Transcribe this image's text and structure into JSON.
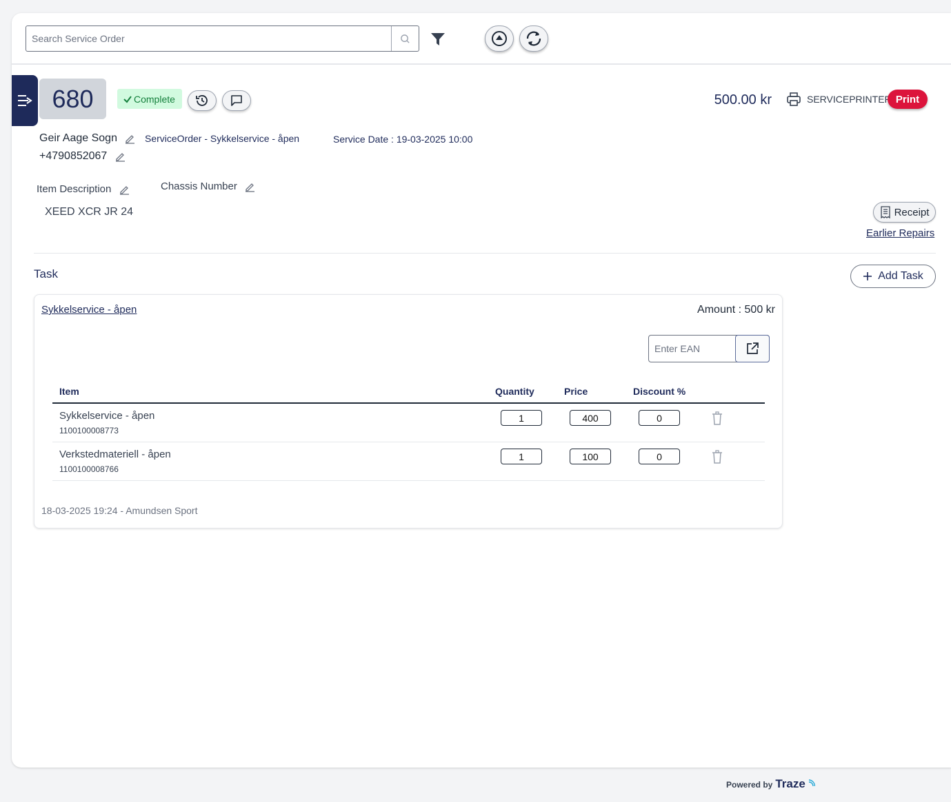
{
  "search": {
    "placeholder": "Search Service Order"
  },
  "order": {
    "number": "680",
    "status": "Complete",
    "total": "500.00 kr",
    "printer_name": "SERVICEPRINTER",
    "print_label": "Print",
    "customer_name": "Geir Aage Sogn",
    "customer_phone": "+4790852067",
    "service_order_label": "ServiceOrder - Sykkelservice - åpen",
    "service_date": "Service Date : 19-03-2025 10:00",
    "item_description_label": "Item Description",
    "item_description_value": "XEED XCR JR 24",
    "chassis_number_label": "Chassis Number",
    "receipt_label": "Receipt",
    "earlier_repairs_label": "Earlier Repairs"
  },
  "task_section": {
    "title": "Task",
    "add_task_label": "Add Task"
  },
  "task": {
    "name": "Sykkelservice - åpen",
    "amount": "Amount : 500 kr",
    "ean_placeholder": "Enter EAN",
    "columns": [
      "Item",
      "Quantity",
      "Price",
      "Discount %"
    ],
    "items": [
      {
        "name": "Sykkelservice - åpen",
        "code": "1100100008773",
        "quantity": "1",
        "price": "400",
        "discount": "0"
      },
      {
        "name": "Verkstedmateriell - åpen",
        "code": "1100100008766",
        "quantity": "1",
        "price": "100",
        "discount": "0"
      }
    ],
    "created": "18-03-2025 19:24 - Amundsen Sport"
  },
  "footer": {
    "powered_by": "Powered by",
    "brand": "Traze"
  },
  "colors": {
    "navy": "#1e2a5a",
    "print_red": "#dc143c",
    "complete_bg": "#d1fadf",
    "complete_text": "#15803d"
  }
}
